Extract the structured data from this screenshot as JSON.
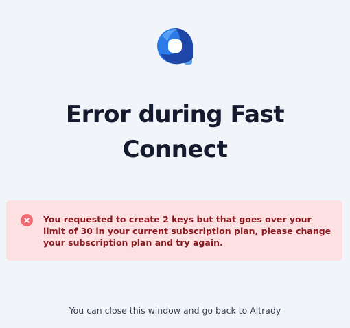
{
  "logo": {
    "icon": "altrady-logo-icon",
    "colors": [
      "#2c7ae6",
      "#1e45a8",
      "#5da4f5"
    ]
  },
  "error": {
    "title_line1": "Error during Fast",
    "title_line2": "Connect",
    "message": "You requested to create 2 keys but that goes over your limit of 30 in your current subscription plan, please change your subscription plan and try again.",
    "icon": "error-x-circle-icon",
    "colors": {
      "background": "#fde1e2",
      "text": "#8b1a20",
      "icon": "#f16b72"
    }
  },
  "footer": {
    "text": "You can close this window and go back to Altrady"
  },
  "colors": {
    "page_background": "#f1f4f9",
    "title": "#141b2e",
    "footer_text": "#3b4253"
  }
}
